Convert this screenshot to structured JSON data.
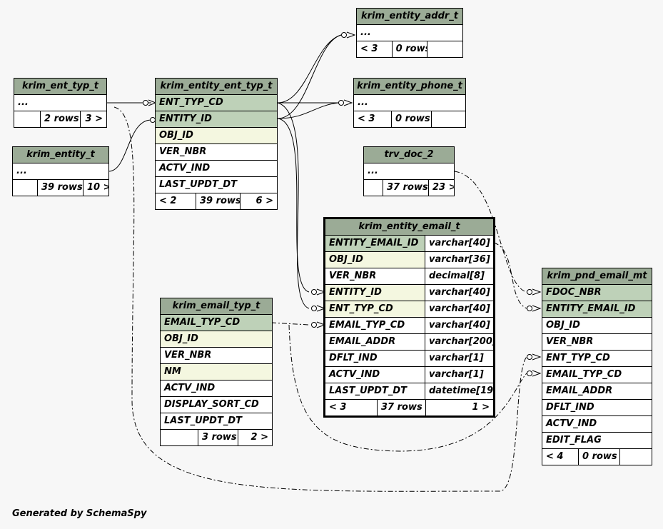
{
  "footer": "Generated by SchemaSpy",
  "tables": {
    "krim_entity_addr_t": {
      "title": "krim_entity_addr_t",
      "ellipsis": "...",
      "stats": [
        "< 3",
        "0 rows",
        ""
      ]
    },
    "krim_ent_typ_t": {
      "title": "krim_ent_typ_t",
      "ellipsis": "...",
      "stats": [
        "",
        "2 rows",
        "3 >"
      ]
    },
    "krim_entity_ent_typ_t": {
      "title": "krim_entity_ent_typ_t",
      "columns": [
        "ENT_TYP_CD",
        "ENTITY_ID",
        "OBJ_ID",
        "VER_NBR",
        "ACTV_IND",
        "LAST_UPDT_DT"
      ],
      "stats": [
        "< 2",
        "39 rows",
        "6 >"
      ]
    },
    "krim_entity_phone_t": {
      "title": "krim_entity_phone_t",
      "ellipsis": "...",
      "stats": [
        "< 3",
        "0 rows",
        ""
      ]
    },
    "krim_entity_t": {
      "title": "krim_entity_t",
      "ellipsis": "...",
      "stats": [
        "",
        "39 rows",
        "10 >"
      ]
    },
    "trv_doc_2": {
      "title": "trv_doc_2",
      "ellipsis": "...",
      "stats": [
        "",
        "37 rows",
        "23 >"
      ]
    },
    "krim_entity_email_t": {
      "title": "krim_entity_email_t",
      "columns": [
        {
          "name": "ENTITY_EMAIL_ID",
          "type": "varchar[40]"
        },
        {
          "name": "OBJ_ID",
          "type": "varchar[36]"
        },
        {
          "name": "VER_NBR",
          "type": "decimal[8]"
        },
        {
          "name": "ENTITY_ID",
          "type": "varchar[40]"
        },
        {
          "name": "ENT_TYP_CD",
          "type": "varchar[40]"
        },
        {
          "name": "EMAIL_TYP_CD",
          "type": "varchar[40]"
        },
        {
          "name": "EMAIL_ADDR",
          "type": "varchar[200]"
        },
        {
          "name": "DFLT_IND",
          "type": "varchar[1]"
        },
        {
          "name": "ACTV_IND",
          "type": "varchar[1]"
        },
        {
          "name": "LAST_UPDT_DT",
          "type": "datetime[19]"
        }
      ],
      "stats": [
        "< 3",
        "37 rows",
        "1 >"
      ]
    },
    "krim_email_typ_t": {
      "title": "krim_email_typ_t",
      "columns": [
        "EMAIL_TYP_CD",
        "OBJ_ID",
        "VER_NBR",
        "NM",
        "ACTV_IND",
        "DISPLAY_SORT_CD",
        "LAST_UPDT_DT"
      ],
      "stats": [
        "",
        "3 rows",
        "2 >"
      ]
    },
    "krim_pnd_email_mt": {
      "title": "krim_pnd_email_mt",
      "columns": [
        "FDOC_NBR",
        "ENTITY_EMAIL_ID",
        "OBJ_ID",
        "VER_NBR",
        "ENT_TYP_CD",
        "EMAIL_TYP_CD",
        "EMAIL_ADDR",
        "DFLT_IND",
        "ACTV_IND",
        "EDIT_FLAG"
      ],
      "stats": [
        "< 4",
        "0 rows",
        ""
      ]
    }
  }
}
